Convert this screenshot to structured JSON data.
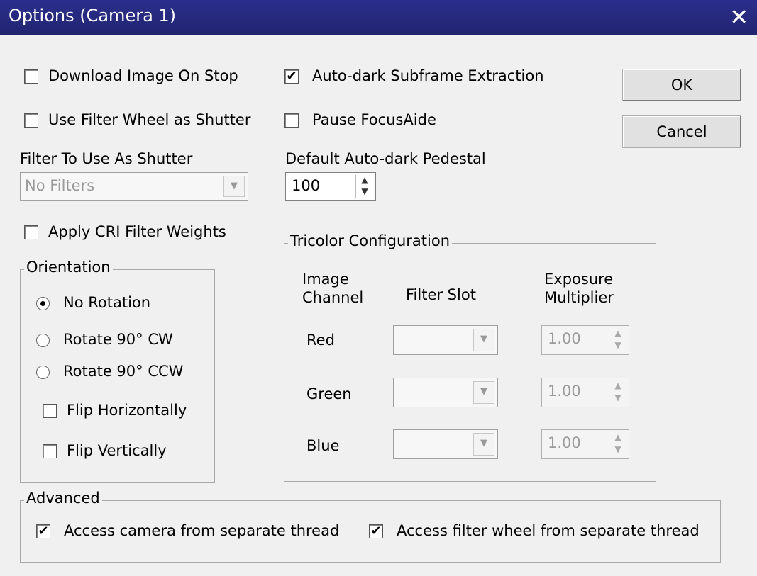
{
  "window": {
    "title": "Options (Camera 1)",
    "close_glyph": "✕"
  },
  "checkboxes": {
    "download_image_on_stop": {
      "label": "Download Image On Stop",
      "checked": false
    },
    "use_filter_wheel_as_shutter": {
      "label": "Use Filter Wheel as Shutter",
      "checked": false
    },
    "auto_dark_subframe": {
      "label": "Auto-dark Subframe Extraction",
      "checked": true
    },
    "pause_focusaide": {
      "label": "Pause FocusAide",
      "checked": false
    },
    "apply_cri": {
      "label": "Apply CRI Filter Weights",
      "checked": false
    }
  },
  "filter_shutter": {
    "label": "Filter To Use As Shutter",
    "value": "No Filters"
  },
  "pedestal": {
    "label": "Default Auto-dark Pedestal",
    "value": "100"
  },
  "buttons": {
    "ok": "OK",
    "cancel": "Cancel"
  },
  "orientation": {
    "legend": "Orientation",
    "radios": [
      {
        "label": "No Rotation",
        "selected": true
      },
      {
        "label": "Rotate 90° CW",
        "selected": false
      },
      {
        "label": "Rotate 90° CCW",
        "selected": false
      }
    ],
    "flip_h": {
      "label": "Flip Horizontally",
      "checked": false
    },
    "flip_v": {
      "label": "Flip Vertically",
      "checked": false
    }
  },
  "tricolor": {
    "legend": "Tricolor Configuration",
    "col_channel_1": "Image",
    "col_channel_2": "Channel",
    "col_filter": "Filter Slot",
    "col_exposure_1": "Exposure",
    "col_exposure_2": "Multiplier",
    "rows": [
      {
        "channel": "Red",
        "filter": "",
        "multiplier": "1.00"
      },
      {
        "channel": "Green",
        "filter": "",
        "multiplier": "1.00"
      },
      {
        "channel": "Blue",
        "filter": "",
        "multiplier": "1.00"
      }
    ]
  },
  "advanced": {
    "legend": "Advanced",
    "camera_thread": {
      "label": "Access camera from separate thread",
      "checked": true
    },
    "filter_thread": {
      "label": "Access filter wheel from separate thread",
      "checked": true
    }
  },
  "glyphs": {
    "check": "✔",
    "dropdown": "▼",
    "spin_up": "▲",
    "spin_down": "▼"
  }
}
